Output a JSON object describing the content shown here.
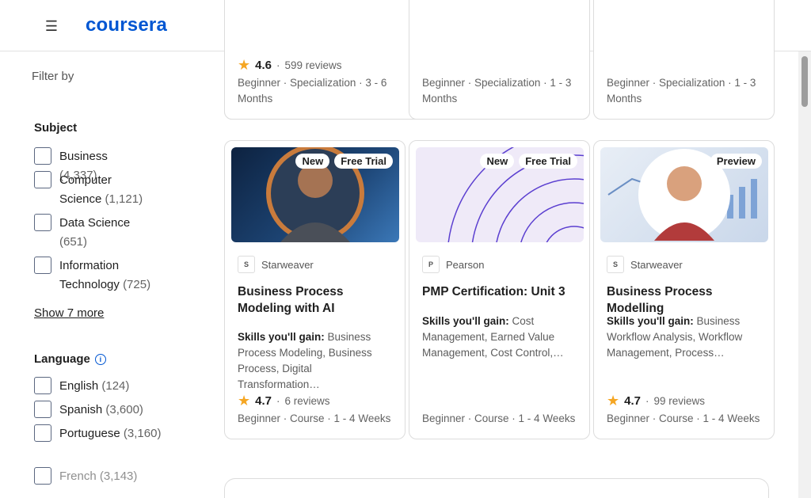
{
  "header": {
    "logo": "coursera",
    "menu_icon": "hamburger-menu-icon"
  },
  "sidebar": {
    "filter_by": "Filter by",
    "subject": {
      "title": "Subject",
      "items": [
        {
          "label": "Business",
          "count": "(4,337)"
        },
        {
          "label": "Computer Science",
          "count": "(1,121)"
        },
        {
          "label": "Data Science",
          "count": "(651)"
        },
        {
          "label": "Information Technology",
          "count": "(725)"
        }
      ],
      "show_more": "Show 7 more"
    },
    "language": {
      "title": "Language",
      "info_icon": "i",
      "items": [
        {
          "label": "English",
          "count": "(124)"
        },
        {
          "label": "Spanish",
          "count": "(3,600)"
        },
        {
          "label": "Portuguese",
          "count": "(3,160)"
        },
        {
          "label": "French",
          "count": "(3,143)"
        }
      ]
    }
  },
  "top_cards": [
    {
      "rating": "4.6",
      "reviews": "599 reviews",
      "meta": "Beginner · Specialization · 3 - 6 Months"
    },
    {
      "meta": "Beginner · Specialization · 1 - 3 Months"
    },
    {
      "meta": "Beginner · Specialization · 1 - 3 Months"
    }
  ],
  "cards": [
    {
      "badges": [
        "New",
        "Free Trial"
      ],
      "partner": "Starweaver",
      "title": "Business Process Modeling with AI",
      "skills_label": "Skills you'll gain:",
      "skills": "Business Process Modeling, Business Process, Digital Transformation…",
      "rating": "4.7",
      "reviews": "6 reviews",
      "meta": "Beginner · Course · 1 - 4 Weeks"
    },
    {
      "badges": [
        "New",
        "Free Trial"
      ],
      "partner": "Pearson",
      "title": "PMP Certification: Unit 3",
      "skills_label": "Skills you'll gain:",
      "skills": "Cost Management, Earned Value Management, Cost Control,…",
      "meta": "Beginner · Course · 1 - 4 Weeks"
    },
    {
      "badges": [
        "Preview"
      ],
      "partner": "Starweaver",
      "title": "Business Process Modelling",
      "skills_label": "Skills you'll gain:",
      "skills": "Business Workflow Analysis, Workflow Management, Process…",
      "rating": "4.7",
      "reviews": "99 reviews",
      "meta": "Beginner · Course · 1 - 4 Weeks"
    }
  ],
  "separator": "·",
  "star": "★"
}
